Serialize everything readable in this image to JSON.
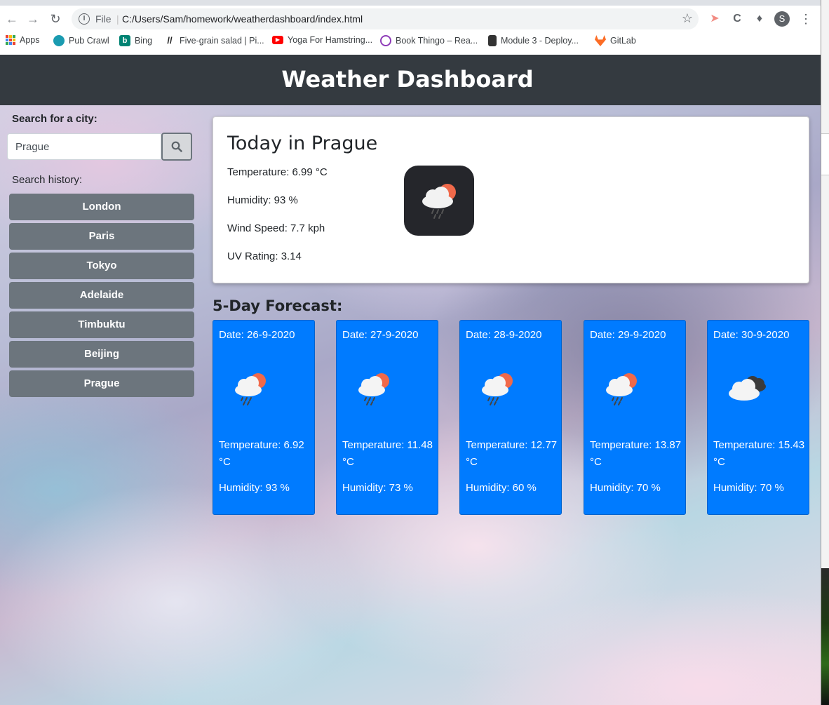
{
  "browser": {
    "file_label": "File",
    "url": "C:/Users/Sam/homework/weatherdashboard/index.html",
    "profile_initial": "S",
    "bookmarks": [
      {
        "label": "Apps",
        "icon": "apps-grid-icon"
      },
      {
        "label": "Pub Crawl",
        "icon": "globe-icon"
      },
      {
        "label": "Bing",
        "icon": "bing-icon"
      },
      {
        "label": "Five-grain salad | Pi...",
        "icon": "slash-logo-icon"
      },
      {
        "label": "Yoga For Hamstring...",
        "icon": "youtube-icon"
      },
      {
        "label": "Book Thingo – Rea...",
        "icon": "book-logo-icon"
      },
      {
        "label": "Module 3 - Deploy...",
        "icon": "notebook-icon"
      },
      {
        "label": "GitLab",
        "icon": "gitlab-icon"
      }
    ]
  },
  "header": {
    "title": "Weather Dashboard"
  },
  "sidebar": {
    "search_label": "Search for a city:",
    "search_value": "Prague",
    "history_label": "Search history:",
    "history": [
      "London",
      "Paris",
      "Tokyo",
      "Adelaide",
      "Timbuktu",
      "Beijing",
      "Prague"
    ]
  },
  "today": {
    "title": "Today in Prague",
    "temperature": "Temperature: 6.99 °C",
    "humidity": "Humidity: 93 %",
    "wind": "Wind Speed: 7.7 kph",
    "uv": "UV Rating: 3.14",
    "icon": "rain-cloud-sun-icon"
  },
  "forecast": {
    "title": "5-Day Forecast:",
    "days": [
      {
        "date": "Date: 26-9-2020",
        "temperature": "Temperature: 6.92 °C",
        "humidity": "Humidity: 93 %",
        "icon": "rain-cloud-sun-icon"
      },
      {
        "date": "Date: 27-9-2020",
        "temperature": "Temperature: 11.48 °C",
        "humidity": "Humidity: 73 %",
        "icon": "rain-cloud-sun-icon"
      },
      {
        "date": "Date: 28-9-2020",
        "temperature": "Temperature: 12.77 °C",
        "humidity": "Humidity: 60 %",
        "icon": "rain-cloud-sun-icon"
      },
      {
        "date": "Date: 29-9-2020",
        "temperature": "Temperature: 13.87 °C",
        "humidity": "Humidity: 70 %",
        "icon": "rain-cloud-sun-icon"
      },
      {
        "date": "Date: 30-9-2020",
        "temperature": "Temperature: 15.43 °C",
        "humidity": "Humidity: 70 %",
        "icon": "cloudy-icon"
      }
    ]
  },
  "colors": {
    "header_bg": "#343a40",
    "history_btn": "#6c757d",
    "forecast_card": "#007bff"
  }
}
